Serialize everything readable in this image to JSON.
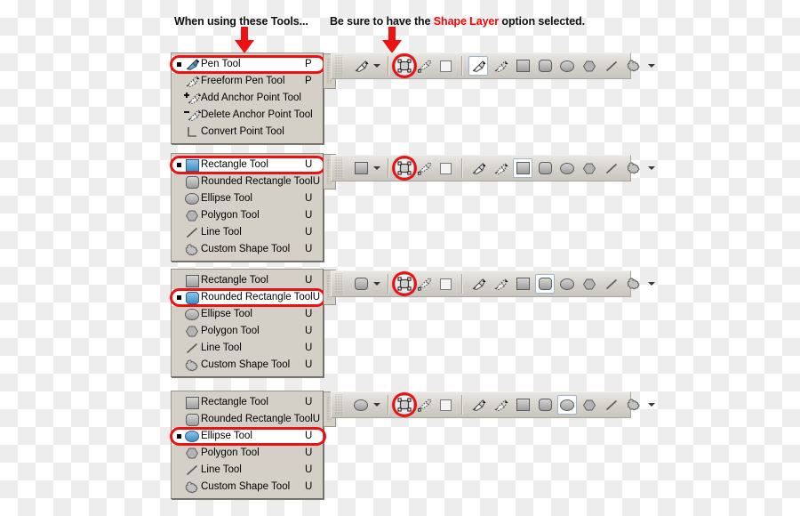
{
  "captions": {
    "left": "When using these Tools...",
    "right_before": "Be sure to have the ",
    "right_highlight": "Shape Layer",
    "right_after": " option selected."
  },
  "colors": {
    "highlight_red": "#ee1111",
    "panel_face": "#d4d0c8",
    "bar_face": "#d3d0c9",
    "selected_blue": "#3f8fc4"
  },
  "menus": [
    {
      "name": "pen-tool-flyout",
      "items": [
        {
          "label": "Pen Tool",
          "key": "P",
          "icon": "pen-icon",
          "selected": true
        },
        {
          "label": "Freeform Pen Tool",
          "key": "P",
          "icon": "freeform-pen-icon",
          "selected": false
        },
        {
          "label": "Add Anchor Point Tool",
          "key": "",
          "icon": "add-anchor-point-icon",
          "selected": false
        },
        {
          "label": "Delete Anchor Point Tool",
          "key": "",
          "icon": "delete-anchor-point-icon",
          "selected": false
        },
        {
          "label": "Convert Point Tool",
          "key": "",
          "icon": "convert-point-icon",
          "selected": false
        }
      ]
    },
    {
      "name": "rectangle-tool-flyout",
      "items": [
        {
          "label": "Rectangle Tool",
          "key": "U",
          "icon": "rectangle-icon",
          "selected": true
        },
        {
          "label": "Rounded Rectangle Tool",
          "key": "U",
          "icon": "rounded-rectangle-icon",
          "selected": false
        },
        {
          "label": "Ellipse Tool",
          "key": "U",
          "icon": "ellipse-icon",
          "selected": false
        },
        {
          "label": "Polygon Tool",
          "key": "U",
          "icon": "polygon-icon",
          "selected": false
        },
        {
          "label": "Line Tool",
          "key": "U",
          "icon": "line-icon",
          "selected": false
        },
        {
          "label": "Custom Shape Tool",
          "key": "U",
          "icon": "custom-shape-icon",
          "selected": false
        }
      ]
    },
    {
      "name": "rounded-rectangle-tool-flyout",
      "items": [
        {
          "label": "Rectangle Tool",
          "key": "U",
          "icon": "rectangle-icon",
          "selected": false
        },
        {
          "label": "Rounded Rectangle Tool",
          "key": "U",
          "icon": "rounded-rectangle-icon",
          "selected": true
        },
        {
          "label": "Ellipse Tool",
          "key": "U",
          "icon": "ellipse-icon",
          "selected": false
        },
        {
          "label": "Polygon Tool",
          "key": "U",
          "icon": "polygon-icon",
          "selected": false
        },
        {
          "label": "Line Tool",
          "key": "U",
          "icon": "line-icon",
          "selected": false
        },
        {
          "label": "Custom Shape Tool",
          "key": "U",
          "icon": "custom-shape-icon",
          "selected": false
        }
      ]
    },
    {
      "name": "ellipse-tool-flyout",
      "items": [
        {
          "label": "Rectangle Tool",
          "key": "U",
          "icon": "rectangle-icon",
          "selected": false
        },
        {
          "label": "Rounded Rectangle Tool",
          "key": "U",
          "icon": "rounded-rectangle-icon",
          "selected": false
        },
        {
          "label": "Ellipse Tool",
          "key": "U",
          "icon": "ellipse-icon",
          "selected": true
        },
        {
          "label": "Polygon Tool",
          "key": "U",
          "icon": "polygon-icon",
          "selected": false
        },
        {
          "label": "Line Tool",
          "key": "U",
          "icon": "line-icon",
          "selected": false
        },
        {
          "label": "Custom Shape Tool",
          "key": "U",
          "icon": "custom-shape-icon",
          "selected": false
        }
      ]
    }
  ],
  "options_bars": [
    {
      "name": "pen-options-bar",
      "tool_preview": "pen-icon",
      "mode_buttons": [
        "shape-layer-icon",
        "paths-icon",
        "fill-pixels-icon"
      ],
      "active_mode_index": 0,
      "shape_buttons": [
        "pen-icon",
        "freeform-pen-icon",
        "rectangle-icon",
        "rounded-rectangle-icon",
        "ellipse-icon",
        "polygon-icon",
        "line-icon",
        "custom-shape-icon"
      ],
      "active_shape_index": 0
    },
    {
      "name": "rectangle-options-bar",
      "tool_preview": "rectangle-icon",
      "mode_buttons": [
        "shape-layer-icon",
        "paths-icon",
        "fill-pixels-icon"
      ],
      "active_mode_index": 0,
      "shape_buttons": [
        "pen-icon",
        "freeform-pen-icon",
        "rectangle-icon",
        "rounded-rectangle-icon",
        "ellipse-icon",
        "polygon-icon",
        "line-icon",
        "custom-shape-icon"
      ],
      "active_shape_index": 2
    },
    {
      "name": "rounded-rectangle-options-bar",
      "tool_preview": "rounded-rectangle-icon",
      "mode_buttons": [
        "shape-layer-icon",
        "paths-icon",
        "fill-pixels-icon"
      ],
      "active_mode_index": 0,
      "shape_buttons": [
        "pen-icon",
        "freeform-pen-icon",
        "rectangle-icon",
        "rounded-rectangle-icon",
        "ellipse-icon",
        "polygon-icon",
        "line-icon",
        "custom-shape-icon"
      ],
      "active_shape_index": 3
    },
    {
      "name": "ellipse-options-bar",
      "tool_preview": "ellipse-icon",
      "mode_buttons": [
        "shape-layer-icon",
        "paths-icon",
        "fill-pixels-icon"
      ],
      "active_mode_index": 0,
      "shape_buttons": [
        "pen-icon",
        "freeform-pen-icon",
        "rectangle-icon",
        "rounded-rectangle-icon",
        "ellipse-icon",
        "polygon-icon",
        "line-icon",
        "custom-shape-icon"
      ],
      "active_shape_index": 4
    }
  ]
}
